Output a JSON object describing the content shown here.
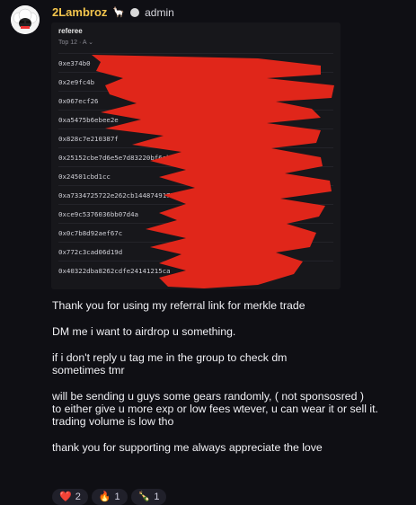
{
  "post": {
    "author": "2Lambroz",
    "author_emoji": "🦙",
    "role": "admin",
    "colors": {
      "author": "#f3c54d",
      "redaction": "#e0261a",
      "background": "#0f0f14"
    }
  },
  "sheet": {
    "title": "referee",
    "filter": "Top 12 · A ⌄",
    "rows": [
      "0xe374b0",
      "0x2e9fc4b",
      "0x067ecf26",
      "0xa5475b6ebee2e",
      "0x828c7e210387f",
      "0x25152cbe7d6e5e7d83220bf6ab9c",
      "0x24501cbd1cc",
      "0xa7334725722e262cb1448749177",
      "0xce9c5376036bb07d4a",
      "0x0c7b8d92aef67c",
      "0x772c3cad06d19d",
      "0x40322dba8262cdfe24141215ca"
    ]
  },
  "message": {
    "paragraphs": [
      "Thank you for using my referral link for merkle trade",
      "DM me i want to airdrop u something.",
      "if i don't reply u tag me in the group to check dm",
      "sometimes tmr",
      "will be sending u guys some gears randomly, ( not sponsosred )",
      "to either give u more exp or low fees wtever, u can wear it or sell it.",
      "trading volume is low tho",
      "thank you for supporting me always appreciate the love"
    ]
  },
  "reactions": [
    {
      "emoji": "❤️",
      "count": "2"
    },
    {
      "emoji": "🔥",
      "count": "1"
    },
    {
      "emoji": "🍾",
      "count": "1"
    }
  ]
}
